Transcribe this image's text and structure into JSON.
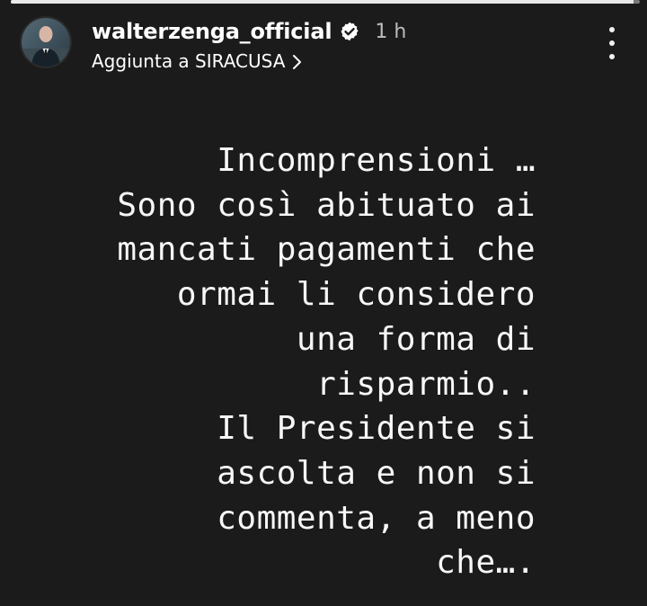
{
  "story": {
    "progress": 0.99,
    "colors": {
      "background": "#1b1b1b",
      "text": "#f7f7f7",
      "progress_track": "#7a7a7a",
      "progress_fill": "#e9e9e9"
    }
  },
  "header": {
    "avatar_icon": "profile-avatar",
    "username": "walterzenga_official",
    "verified_icon": "verified-badge-icon",
    "time": "1 h",
    "subtitle": "Aggiunta a SIRACUSA",
    "chevron_icon": "chevron-right-icon",
    "menu_icon": "more-options-icon"
  },
  "caption": {
    "lines": [
      "Incomprensioni …",
      "Sono così abituato ai",
      "mancati pagamenti che",
      "ormai li considero",
      "una forma di",
      "risparmio..",
      "Il Presidente si",
      "ascolta e non si",
      "commenta, a meno",
      "che…."
    ]
  }
}
